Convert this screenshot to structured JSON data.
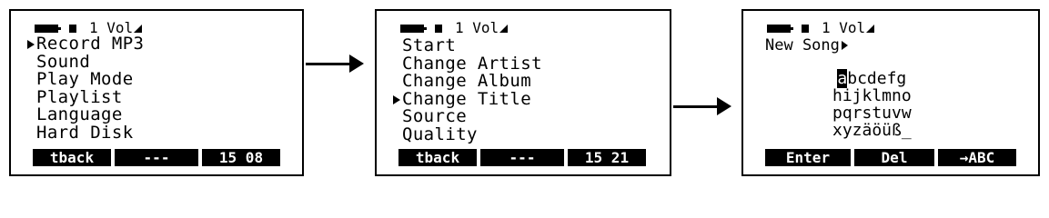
{
  "screens": [
    {
      "status": {
        "text": "1 Vol"
      },
      "menu": [
        "Record MP3",
        "Sound",
        "Play Mode",
        "Playlist",
        "Language",
        "Hard Disk"
      ],
      "selected_index": 0,
      "softkeys": [
        "tback",
        "---",
        "15 08"
      ]
    },
    {
      "status": {
        "text": "1 Vol"
      },
      "menu": [
        "Start",
        "Change Artist",
        "Change Album",
        "Change Title",
        "Source",
        "Quality"
      ],
      "selected_index": 3,
      "softkeys": [
        "tback",
        "---",
        "15 21"
      ]
    },
    {
      "status": {
        "text": "1 Vol"
      },
      "title": "New Song",
      "charset": {
        "selected_char": "a",
        "row1_rest": "bcdefg",
        "row2": "hijklmno",
        "row3": "pqrstuvw",
        "row4": "xyzäöüß_"
      },
      "softkeys": [
        "Enter",
        "Del",
        "→ABC"
      ]
    }
  ]
}
